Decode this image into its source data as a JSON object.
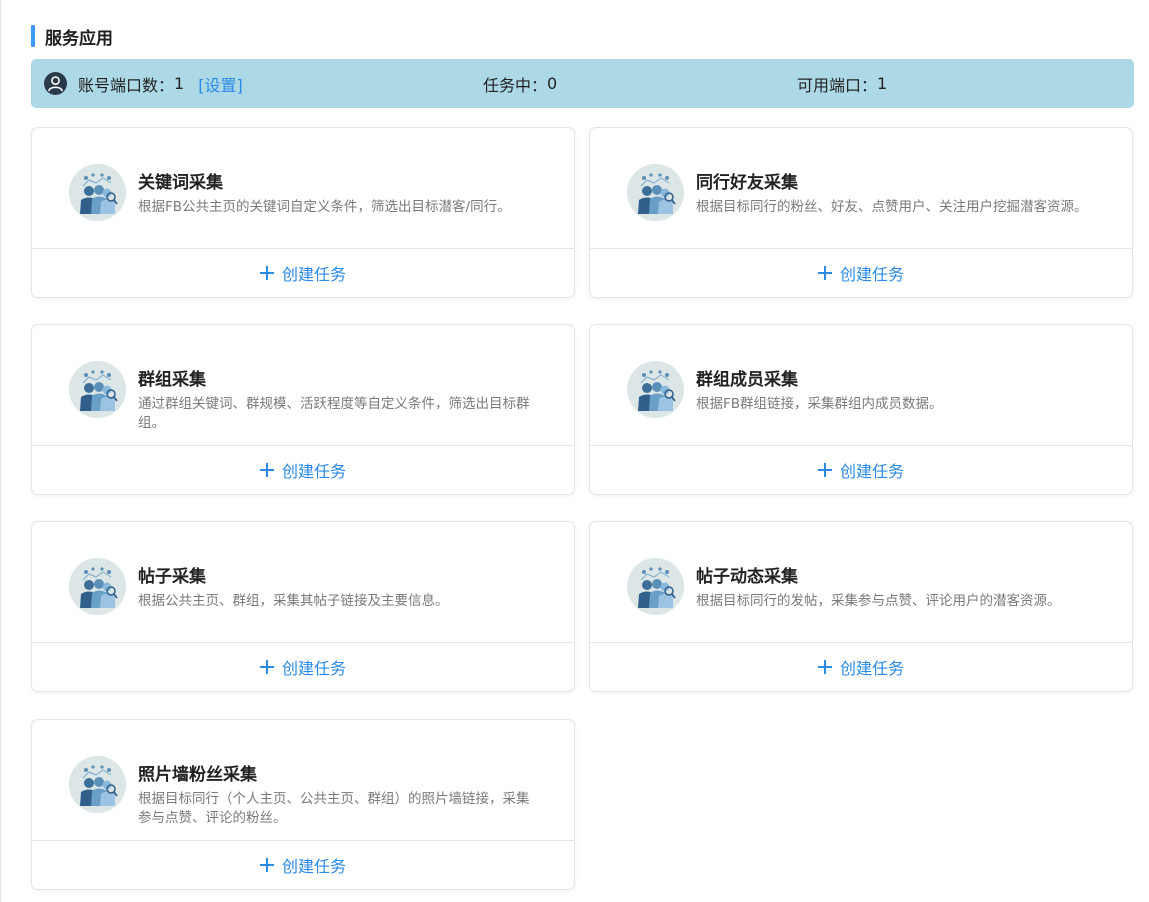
{
  "section": {
    "title": "服务应用"
  },
  "stats": {
    "ports_label": "账号端口数：",
    "ports_value": "1",
    "settings_link": "[设置]",
    "tasks_label": "任务中：",
    "tasks_value": "0",
    "available_label": "可用端口：",
    "available_value": "1"
  },
  "cards": [
    {
      "title": "关键词采集",
      "desc": "根据FB公共主页的关键词自定义条件，筛选出目标潜客/同行。",
      "action": "创建任务",
      "icon": "people-analytics-icon"
    },
    {
      "title": "同行好友采集",
      "desc": "根据目标同行的粉丝、好友、点赞用户、关注用户挖掘潜客资源。",
      "action": "创建任务",
      "icon": "people-analytics-icon"
    },
    {
      "title": "群组采集",
      "desc": "通过群组关键词、群规模、活跃程度等自定义条件，筛选出目标群组。",
      "action": "创建任务",
      "icon": "people-analytics-icon"
    },
    {
      "title": "群组成员采集",
      "desc": "根据FB群组链接，采集群组内成员数据。",
      "action": "创建任务",
      "icon": "people-analytics-icon"
    },
    {
      "title": "帖子采集",
      "desc": "根据公共主页、群组，采集其帖子链接及主要信息。",
      "action": "创建任务",
      "icon": "people-analytics-icon"
    },
    {
      "title": "帖子动态采集",
      "desc": "根据目标同行的发帖，采集参与点赞、评论用户的潜客资源。",
      "action": "创建任务",
      "icon": "people-analytics-icon"
    },
    {
      "title": "照片墙粉丝采集",
      "desc": "根据目标同行（个人主页、公共主页、群组）的照片墙链接，采集参与点赞、评论的粉丝。",
      "action": "创建任务",
      "icon": "people-analytics-icon"
    }
  ],
  "colors": {
    "accent": "#2a8ae6",
    "stats_bg": "#add8e6",
    "title_bar": "#3b9cf5"
  }
}
